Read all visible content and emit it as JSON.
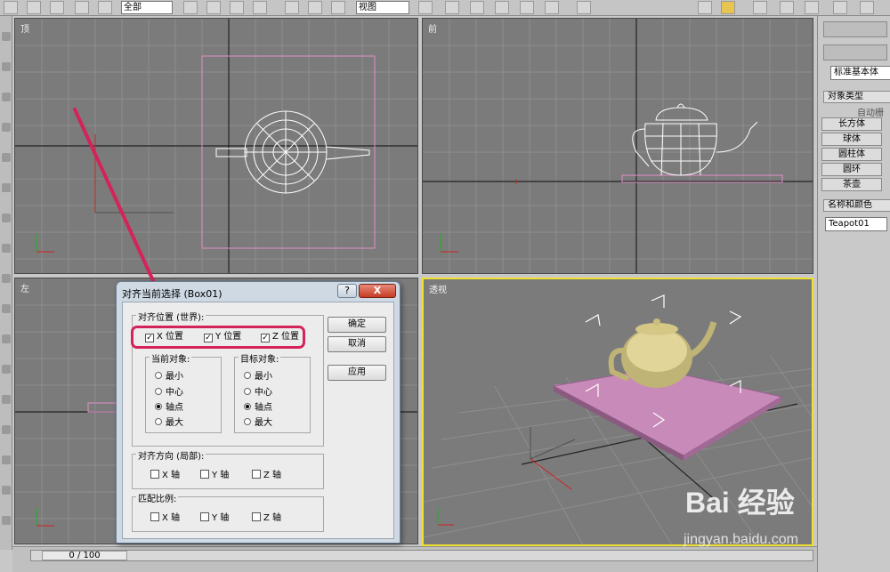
{
  "toolbar": {
    "select_filter": "全部",
    "ref_coord": "视图"
  },
  "viewports": {
    "top": "顶",
    "front": "前",
    "left": "左",
    "perspective": "透视"
  },
  "right_panel": {
    "category_dropdown": "标准基本体",
    "object_type_header": "对象类型",
    "autogrid": "自动栅格",
    "buttons": [
      "长方体",
      "球体",
      "圆柱体",
      "圆环",
      "茶壶"
    ],
    "name_color_header": "名称和颜色",
    "object_name": "Teapot01"
  },
  "dialog": {
    "title": "对齐当前选择 (Box01)",
    "help_label": "?",
    "close_label": "X",
    "align_position_title": "对齐位置 (世界):",
    "x_pos": "X 位置",
    "y_pos": "Y 位置",
    "z_pos": "Z 位置",
    "current_object_title": "当前对象:",
    "target_object_title": "目标对象:",
    "opt_min": "最小",
    "opt_center": "中心",
    "opt_pivot": "轴点",
    "opt_max": "最大",
    "align_orient_title": "对齐方向 (局部):",
    "match_scale_title": "匹配比例:",
    "x_axis": "X 轴",
    "y_axis": "Y 轴",
    "z_axis": "Z 轴",
    "ok": "确定",
    "cancel": "取消",
    "apply": "应用",
    "checkmark": "✓"
  },
  "timeline": {
    "frame": "0 / 100"
  },
  "watermark": {
    "brand": "Bai 经验",
    "url": "jingyan.baidu.com"
  },
  "colors": {
    "highlight": "#d4235a",
    "active_viewport": "#f0e030",
    "plane": "#c88ab8"
  }
}
